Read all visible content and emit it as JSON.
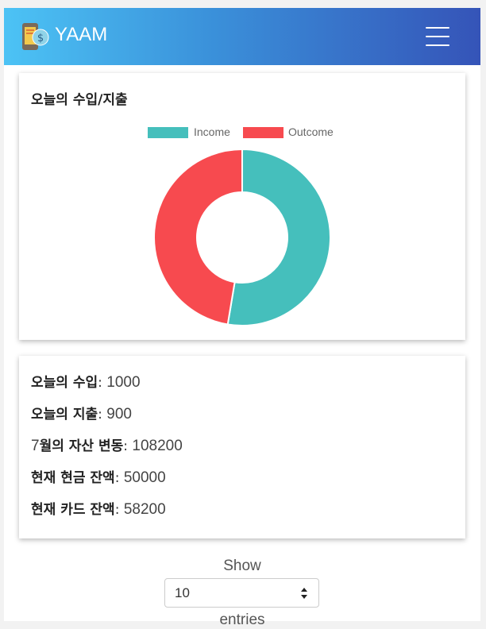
{
  "navbar": {
    "brand": "YAAM",
    "brand_icon": "phone-money-icon",
    "menu_icon": "hamburger-icon"
  },
  "today_chart": {
    "title": "오늘의 수입/지출",
    "chart_data": {
      "type": "pie",
      "variant": "doughnut",
      "categories": [
        "Income",
        "Outcome"
      ],
      "values": [
        1000,
        900
      ],
      "colors": [
        "#45bfbc",
        "#f74a4f"
      ],
      "legend": "top"
    }
  },
  "summary": {
    "items": [
      {
        "label": "오늘의 수입",
        "value": "1000"
      },
      {
        "label": "오늘의 지출",
        "value": "900"
      },
      {
        "label_prefix": "7",
        "label": "월의 자산 변동",
        "value": "108200"
      },
      {
        "label": "현재 현금 잔액",
        "value": "50000"
      },
      {
        "label": "현재 카드 잔액",
        "value": "58200"
      }
    ]
  },
  "table_controls": {
    "show_label": "Show",
    "entries_value": "10",
    "entries_label": "entries"
  }
}
